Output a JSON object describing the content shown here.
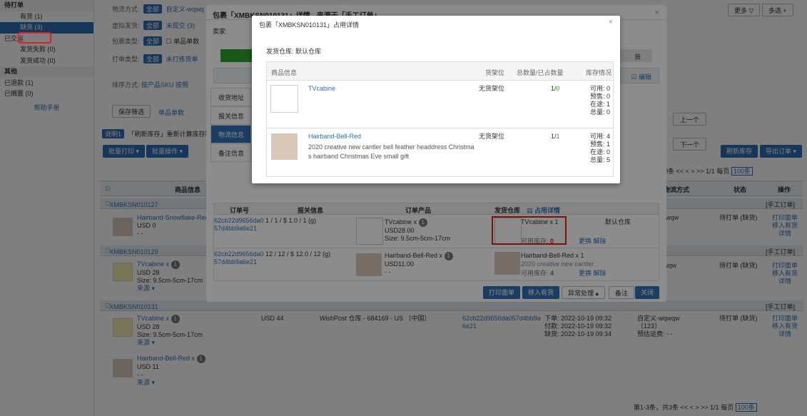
{
  "sidebar": {
    "items": [
      {
        "label": "待打单",
        "kind": "grp"
      },
      {
        "label": "有货 (1)",
        "kind": "sub"
      },
      {
        "label": "缺货 (3)",
        "kind": "sub act"
      },
      {
        "label": "已交运",
        "kind": ""
      },
      {
        "label": "发货失败 (0)",
        "kind": "sub"
      },
      {
        "label": "发货成功 (0)",
        "kind": "sub"
      },
      {
        "label": "其他",
        "kind": "grp"
      },
      {
        "label": "已退款 (1)",
        "kind": ""
      },
      {
        "label": "已搁置 (0)",
        "kind": ""
      }
    ],
    "help": "帮助手册"
  },
  "filters": {
    "logistics_label": "物流方式:",
    "logistics_all": "全部",
    "logistics_custom": "自定义-wqwq",
    "virtual_label": "虚拟发货:",
    "virtual_all": "全部",
    "virtual_unsubmitted": "未提交 (3)",
    "package_label": "包裹类型:",
    "package_all": "全部",
    "package_single": "单品单数",
    "print_label": "打单类型:",
    "print_all": "全部",
    "print_unprinted": "未打拣货单",
    "sort_label": "排序方式:",
    "sort_sku": "按产品SKU",
    "sort_more": "按照",
    "save_filter": "保存筛选",
    "single_qty": "单品单数",
    "note_tag": "说明1",
    "note_text": "「刷新库存」重新计算库存取..."
  },
  "toolbar": {
    "batch_print": "批量打印 ▾",
    "batch_ops": "批量操作 ▾",
    "more": "更多 ▽",
    "multi": "多选 +",
    "refresh_stock": "刷新库存",
    "export": "导出订单 ▾",
    "prev": "上一个",
    "next": "下一个"
  },
  "pager_top": {
    "per_page": "0条",
    "pages": "1/1",
    "per_label": "每页",
    "per_value": "100条"
  },
  "pager_bottom": {
    "summary": "第1-3条，共3条",
    "pages": "1/1",
    "per_label": "每页",
    "per_value": "100条"
  },
  "table": {
    "headers": {
      "check": "□",
      "product": "商品信息",
      "logistics": "物流方式",
      "status": "状态",
      "ops": "操作"
    },
    "groups": [
      {
        "id": "XMBKSN010127",
        "type": "[手工订单]"
      },
      {
        "id": "XMBKSN010129",
        "type": "[手工订单]"
      },
      {
        "id": "XMBKSN010131",
        "type": "[手工订单]"
      }
    ],
    "rows": [
      {
        "name": "Hairband-Snowflake-Red",
        "price": "USD 0",
        "extra": "- -",
        "logistics": "-wqw",
        "status": "待打单 (缺货)",
        "ops": [
          "打印面单",
          "移入有货",
          "详情"
        ]
      },
      {
        "name": "TVcabine x",
        "qty": "1",
        "price": "USD 28",
        "size": "Size: 9.5cm-5cm-17cm",
        "src": "来源 ▾",
        "logistics": "wqw",
        "status": "待打单 (缺货)",
        "ops": [
          "打印面单",
          "移入有货",
          "详情"
        ]
      },
      {
        "name": "TVcabine x",
        "qty": "1",
        "price": "USD 28",
        "size": "Size: 9.5cm-5cm-17cm",
        "src": "来源 ▾",
        "amount": "USD 44",
        "ship": "WishPost 仓库 - 684169 - US 〔中国〕",
        "order_id": "62cb22d9656da057d4bb9a6e21",
        "t1": "下单: 2022-10-19 09:32",
        "t2": "付款: 2022-10-19 09:32",
        "t3": "缺货: 2022-10-19 09:34",
        "logistics": "自定义-wqwqw",
        "lg2": "〔123〕",
        "lg3": "预估运费: - -",
        "status": "待打单 (缺货)",
        "ops": [
          "打印面单",
          "移入有货",
          "详情"
        ]
      },
      {
        "name": "Hairband-Bell-Red x",
        "qty": "1",
        "price": "USD 11",
        "extra": "- -",
        "src": "来源 ▾"
      }
    ]
  },
  "detail_modal": {
    "title": "包裹「XMBKSN010131」详情 - 来源于「手工订单」",
    "seller_label": "卖家:",
    "progress_tail": "货",
    "edit": "☑ 编辑",
    "tabs": [
      "收货地址",
      "报关信息",
      "物流信息",
      "备注信息"
    ],
    "cols": {
      "order_no": "订单号",
      "customs": "报关信息",
      "product": "订单产品",
      "warehouse": "发货仓库",
      "occupy": "占用详情"
    },
    "rows": [
      {
        "order_no": "62cb22d9656da057d4bb9a6e21",
        "customs": "1 / 1 / $ 1.0 / 1 (g)",
        "prod_name": "TVcabine x",
        "prod_qty": "1",
        "prod_price": "USD28.00",
        "prod_size": "Size: 9.5cm-5cm-17cm",
        "wh_item": "TVcabine x 1",
        "wh_stock_label": "可用库存:",
        "wh_stock": "0",
        "wh_change": "更换",
        "wh_release": "解除",
        "wh_name": "默认仓库"
      },
      {
        "order_no": "62cb22d9656da057d4bb9a6e21",
        "customs": "12 / 12 / $ 12.0 / 12 (g)",
        "prod_name": "Hairband-Bell-Red x",
        "prod_qty": "1",
        "prod_price": "USD11.00",
        "prod_extra": "- -",
        "wh_item": "Hairband-Bell-Red x 1",
        "wh_desc": "2020 creative new cantler",
        "wh_stock_label": "可用库存:",
        "wh_stock": "4",
        "wh_change": "更换",
        "wh_release": "解除"
      }
    ],
    "buttons": {
      "print": "打印面单",
      "move": "移入有货",
      "exception": "异常处理 ▴",
      "note": "备注",
      "close": "关闭"
    }
  },
  "occupy_modal": {
    "title": "包裹「XMBKSN010131」占用详情",
    "warehouse": "发货仓库: 默认仓库",
    "headers": {
      "product": "商品信息",
      "shelf": "货架位",
      "qty": "总数量/已占数量",
      "stock": "库存情况"
    },
    "items": [
      {
        "name": "TVcabine",
        "desc1": "",
        "desc2": "",
        "shelf": "无货架位",
        "total": "1",
        "used": "0",
        "avail": "可用: 0",
        "pre": "预售: 0",
        "transit": "在途: 1",
        "sum": "总量: 0"
      },
      {
        "name": "Hairband-Bell-Red",
        "desc1": "2020 creative new cantler bell feather headdress Christma",
        "desc2": "s hairband Christmas Eve small gift",
        "shelf": "无货架位",
        "total": "1",
        "used": "1",
        "avail": "可用: 4",
        "pre": "预售: 1",
        "transit": "在途: 0",
        "sum": "总量: 5"
      }
    ]
  }
}
